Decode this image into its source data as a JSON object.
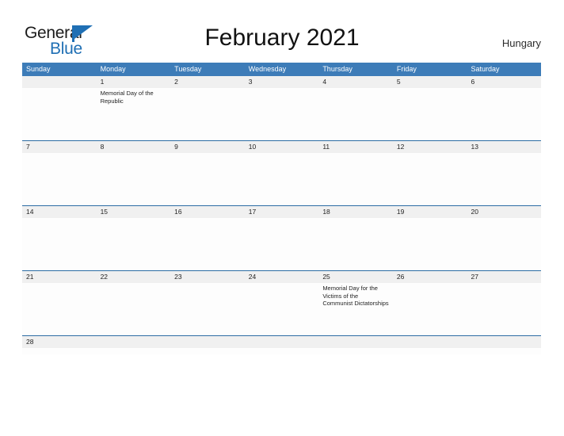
{
  "logo": {
    "word_one": "General",
    "word_two": "Blue",
    "flag_icon": "blue-triangle-flag-icon",
    "blue": "#1f6fb4"
  },
  "header": {
    "title": "February 2021",
    "country": "Hungary"
  },
  "theme": {
    "header_blue": "#3d7cb8",
    "rule_blue": "#2d6da4",
    "band_gray": "#f0f0f0",
    "body_white": "#fdfdfd",
    "text": "#232323"
  },
  "calendar": {
    "day_headers": [
      "Sunday",
      "Monday",
      "Tuesday",
      "Wednesday",
      "Thursday",
      "Friday",
      "Saturday"
    ],
    "weeks": [
      {
        "size": "tall",
        "days": [
          {
            "num": "",
            "event": ""
          },
          {
            "num": "1",
            "event": "Memorial Day of the Republic"
          },
          {
            "num": "2",
            "event": ""
          },
          {
            "num": "3",
            "event": ""
          },
          {
            "num": "4",
            "event": ""
          },
          {
            "num": "5",
            "event": ""
          },
          {
            "num": "6",
            "event": ""
          }
        ]
      },
      {
        "size": "tall",
        "days": [
          {
            "num": "7",
            "event": ""
          },
          {
            "num": "8",
            "event": ""
          },
          {
            "num": "9",
            "event": ""
          },
          {
            "num": "10",
            "event": ""
          },
          {
            "num": "11",
            "event": ""
          },
          {
            "num": "12",
            "event": ""
          },
          {
            "num": "13",
            "event": ""
          }
        ]
      },
      {
        "size": "tall",
        "days": [
          {
            "num": "14",
            "event": ""
          },
          {
            "num": "15",
            "event": ""
          },
          {
            "num": "16",
            "event": ""
          },
          {
            "num": "17",
            "event": ""
          },
          {
            "num": "18",
            "event": ""
          },
          {
            "num": "19",
            "event": ""
          },
          {
            "num": "20",
            "event": ""
          }
        ]
      },
      {
        "size": "tall",
        "days": [
          {
            "num": "21",
            "event": ""
          },
          {
            "num": "22",
            "event": ""
          },
          {
            "num": "23",
            "event": ""
          },
          {
            "num": "24",
            "event": ""
          },
          {
            "num": "25",
            "event": "Memorial Day for the Victims of the Communist Dictatorships"
          },
          {
            "num": "26",
            "event": ""
          },
          {
            "num": "27",
            "event": ""
          }
        ]
      },
      {
        "size": "last",
        "days": [
          {
            "num": "28",
            "event": ""
          },
          {
            "num": "",
            "event": ""
          },
          {
            "num": "",
            "event": ""
          },
          {
            "num": "",
            "event": ""
          },
          {
            "num": "",
            "event": ""
          },
          {
            "num": "",
            "event": ""
          },
          {
            "num": "",
            "event": ""
          }
        ]
      }
    ]
  }
}
